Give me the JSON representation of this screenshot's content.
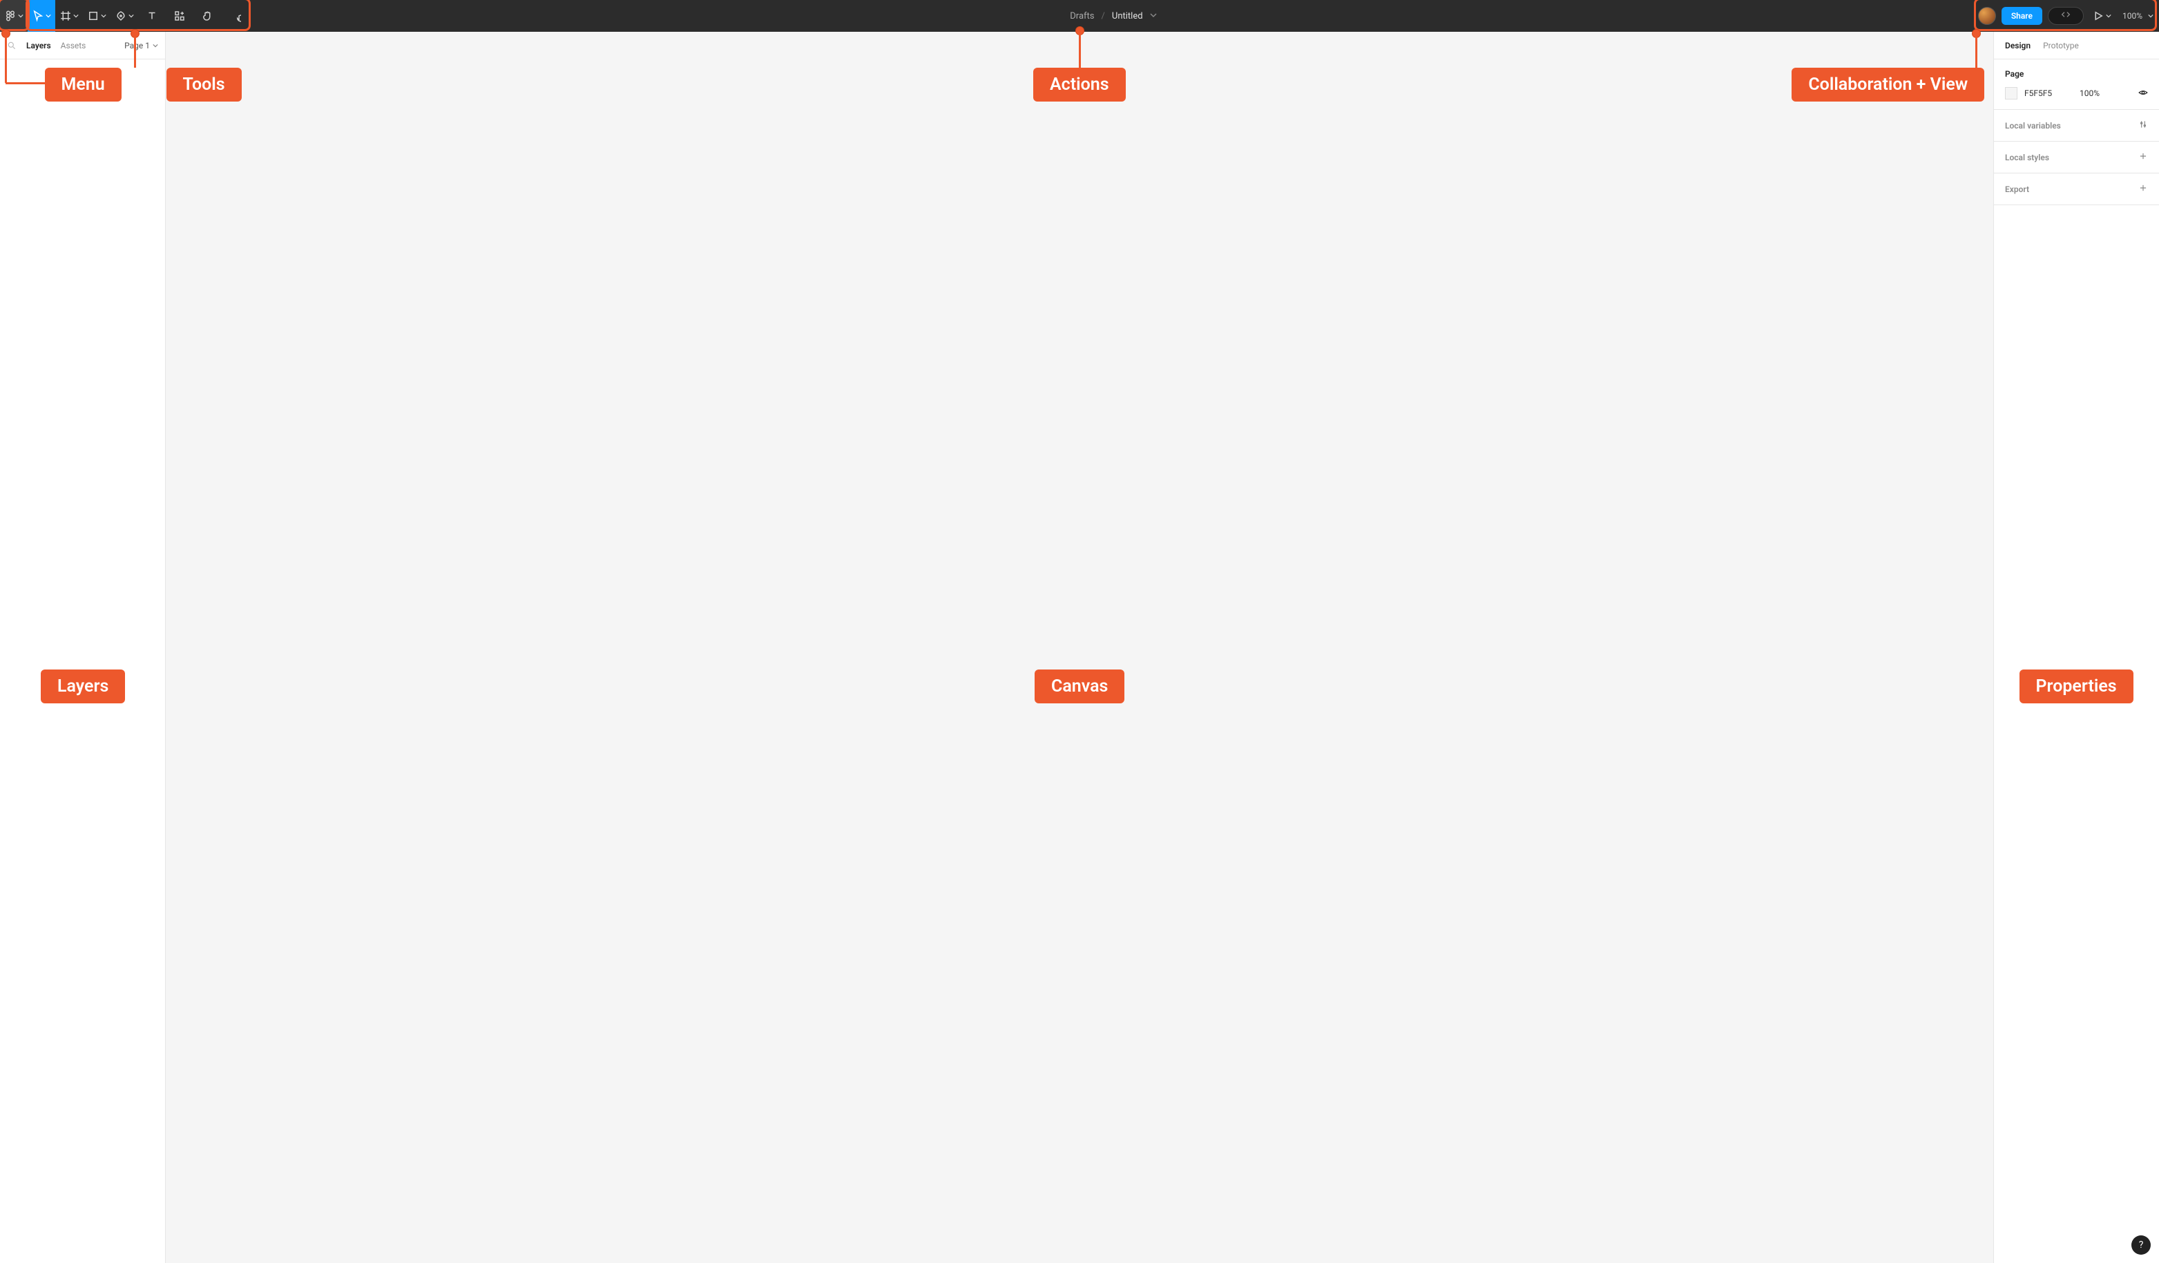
{
  "breadcrumb": {
    "parent": "Drafts",
    "title": "Untitled"
  },
  "toolbar": {
    "share_label": "Share",
    "zoom_label": "100%"
  },
  "left_panel": {
    "tabs": {
      "layers": "Layers",
      "assets": "Assets"
    },
    "page_label": "Page 1"
  },
  "right_panel": {
    "tabs": {
      "design": "Design",
      "prototype": "Prototype"
    },
    "page_section_title": "Page",
    "page_color_hex": "F5F5F5",
    "page_color_opacity": "100%",
    "local_variables_title": "Local variables",
    "local_styles_title": "Local styles",
    "export_title": "Export"
  },
  "annotations": {
    "menu": "Menu",
    "tools": "Tools",
    "actions": "Actions",
    "collab": "Collaboration + View",
    "layers": "Layers",
    "canvas": "Canvas",
    "properties": "Properties"
  },
  "help_label": "?"
}
